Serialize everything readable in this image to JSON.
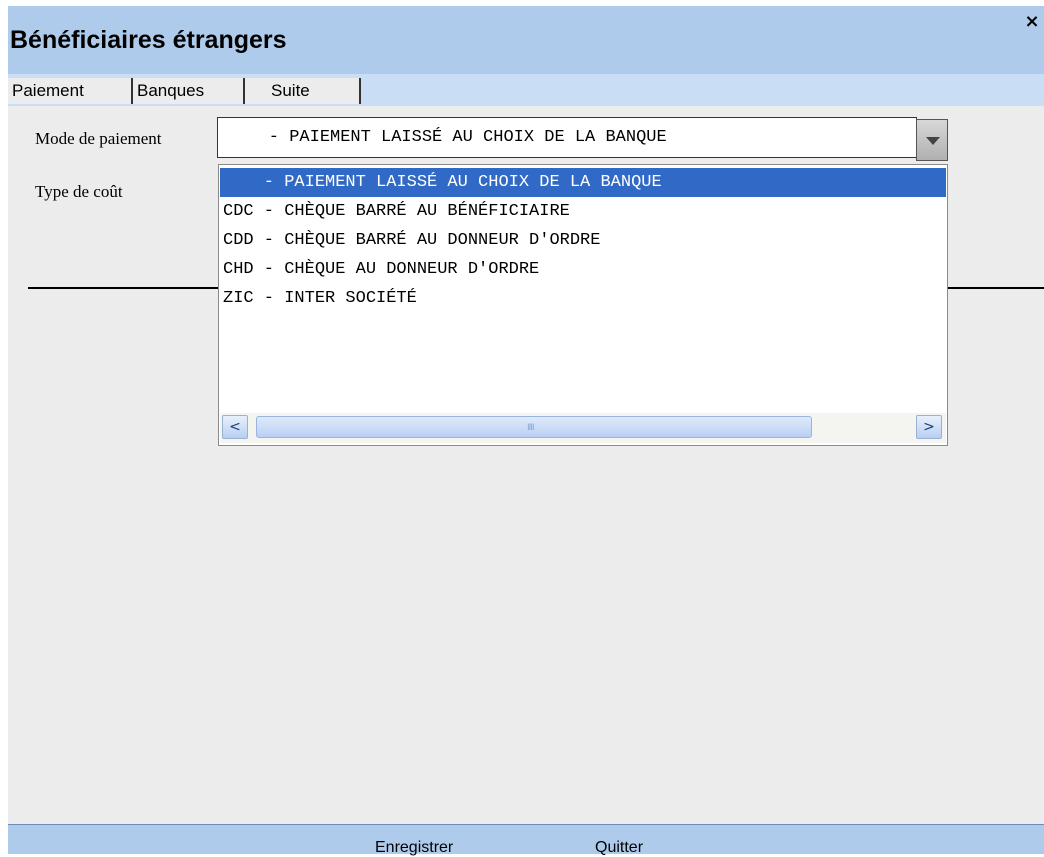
{
  "window": {
    "title": "Bénéficiaires étrangers",
    "close_label": "×"
  },
  "tabs": [
    {
      "label": "Paiement",
      "active": false
    },
    {
      "label": "Banques",
      "active": false
    },
    {
      "label": "Suite",
      "active": true
    }
  ],
  "form": {
    "mode_label": "Mode de paiement",
    "mode_value": "    - PAIEMENT LAISSÉ AU CHOIX DE LA BANQUE",
    "cost_label": "Type de coût"
  },
  "dropdown": {
    "options": [
      "    - PAIEMENT LAISSÉ AU CHOIX DE LA BANQUE",
      "CDC - CHÈQUE BARRÉ AU BÉNÉFICIAIRE",
      "CDD - CHÈQUE BARRÉ AU DONNEUR D'ORDRE",
      "CHD - CHÈQUE AU DONNEUR D'ORDRE",
      "ZIC - INTER SOCIÉTÉ"
    ],
    "selected_index": 0,
    "scroll_left_icon": "<",
    "scroll_right_icon": ">",
    "grip_icon": "IIII"
  },
  "footer": {
    "save_label": "Enregistrer",
    "quit_label": "Quitter"
  },
  "colors": {
    "titlebar": "#aecbeb",
    "selection": "#3169c6"
  }
}
